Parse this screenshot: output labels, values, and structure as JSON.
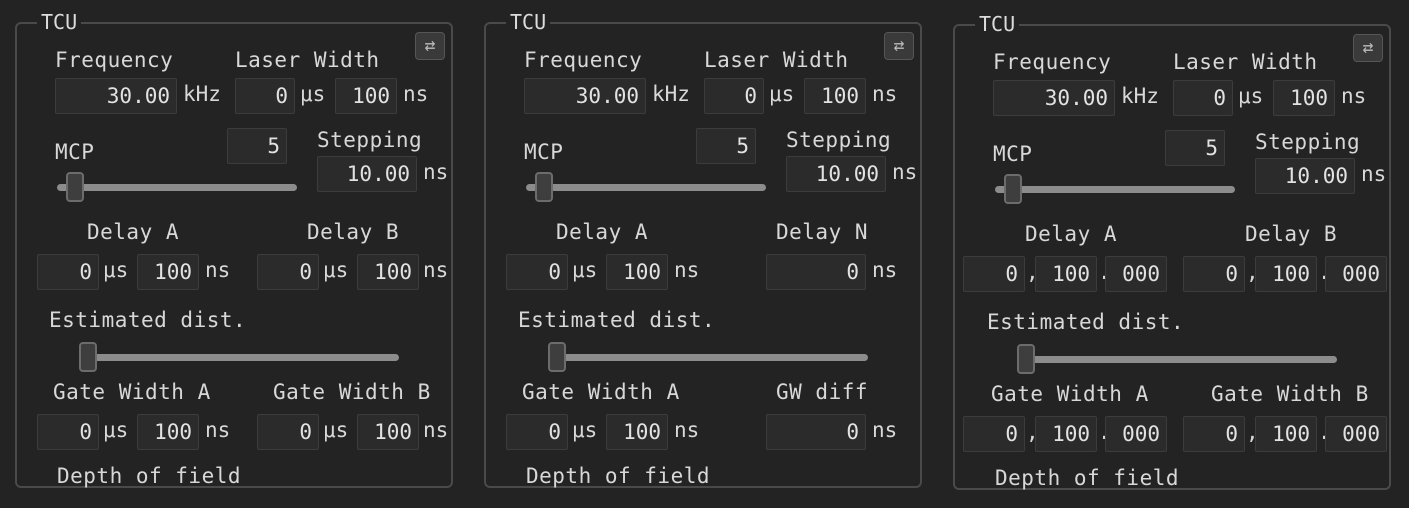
{
  "panels": [
    {
      "title": "TCU",
      "swap_icon": "⇄",
      "frequency_label": "Frequency",
      "frequency_value": "30.00",
      "frequency_unit": "kHz",
      "laser_width_label": "Laser Width",
      "laser_us": "0",
      "laser_ns": "100",
      "unit_us": "μs",
      "unit_ns": "ns",
      "mcp_label": "MCP",
      "mcp_value": "5",
      "mcp_slider_level": 0.04,
      "stepping_label": "Stepping",
      "stepping_value": "10.00",
      "delay_a_label": "Delay A",
      "delay_a_us": "0",
      "delay_a_ns": "100",
      "delay_b_label": "Delay B",
      "delay_b_us": "0",
      "delay_b_ns": "100",
      "est_dist_label": "Estimated dist.",
      "est_dist_level": 0.0,
      "gw_a_label": "Gate Width A",
      "gw_a_us": "0",
      "gw_a_ns": "100",
      "gw_b_label": "Gate Width B",
      "gw_b_us": "0",
      "gw_b_ns": "100",
      "dof_label": "Depth of field"
    },
    {
      "title": "TCU",
      "swap_icon": "⇄",
      "frequency_label": "Frequency",
      "frequency_value": "30.00",
      "frequency_unit": "kHz",
      "laser_width_label": "Laser Width",
      "laser_us": "0",
      "laser_ns": "100",
      "unit_us": "μs",
      "unit_ns": "ns",
      "mcp_label": "MCP",
      "mcp_value": "5",
      "mcp_slider_level": 0.04,
      "stepping_label": "Stepping",
      "stepping_value": "10.00",
      "delay_a_label": "Delay A",
      "delay_a_us": "0",
      "delay_a_ns": "100",
      "delay_n_label": "Delay N",
      "delay_n_value": "0",
      "est_dist_label": "Estimated dist.",
      "est_dist_level": 0.0,
      "gw_a_label": "Gate Width A",
      "gw_a_us": "0",
      "gw_a_ns": "100",
      "gw_diff_label": "GW diff",
      "gw_diff_value": "0",
      "dof_label": "Depth of field"
    },
    {
      "title": "TCU",
      "swap_icon": "⇄",
      "frequency_label": "Frequency",
      "frequency_value": "30.00",
      "frequency_unit": "kHz",
      "laser_width_label": "Laser Width",
      "laser_us": "0",
      "laser_ns": "100",
      "unit_us": "μs",
      "unit_ns": "ns",
      "mcp_label": "MCP",
      "mcp_value": "5",
      "mcp_slider_level": 0.04,
      "stepping_label": "Stepping",
      "stepping_value": "10.00",
      "delay_a_label": "Delay A",
      "delay_a_p1": "0",
      "delay_a_p2": "100",
      "delay_a_p3": "000",
      "delay_b_label": "Delay B",
      "delay_b_p1": "0",
      "delay_b_p2": "100",
      "delay_b_p3": "000",
      "sep_comma": ",",
      "sep_dot": ".",
      "est_dist_label": "Estimated dist.",
      "est_dist_level": 0.0,
      "gw_a_label": "Gate Width A",
      "gw_a_p1": "0",
      "gw_a_p2": "100",
      "gw_a_p3": "000",
      "gw_b_label": "Gate Width B",
      "gw_b_p1": "0",
      "gw_b_p2": "100",
      "gw_b_p3": "000",
      "dof_label": "Depth of field"
    }
  ]
}
